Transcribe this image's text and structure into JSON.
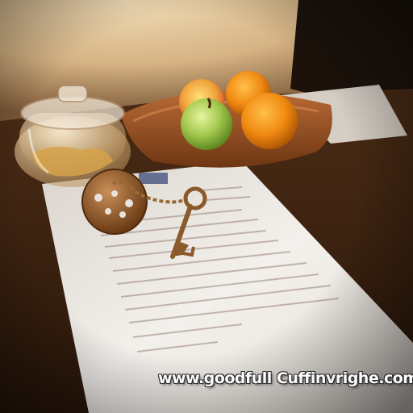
{
  "scene": {
    "objects": [
      {
        "name": "glass-cookie-jar"
      },
      {
        "name": "wooden-fruit-tray"
      },
      {
        "name": "green-apple"
      },
      {
        "name": "red-yellow-apple"
      },
      {
        "name": "orange"
      },
      {
        "name": "vintage-key-with-medallion"
      },
      {
        "name": "letter-document"
      }
    ],
    "colors": {
      "wall": "#d9b88a",
      "table": "#4a2a14",
      "tray": "#a0582a",
      "paper": "#ece8e2",
      "orange": "#f08a12",
      "green_apple": "#9cc24a",
      "key_metal": "#8a5a2a"
    }
  },
  "watermark": {
    "text": "www.goodfull Cuffinvrighe.com"
  }
}
